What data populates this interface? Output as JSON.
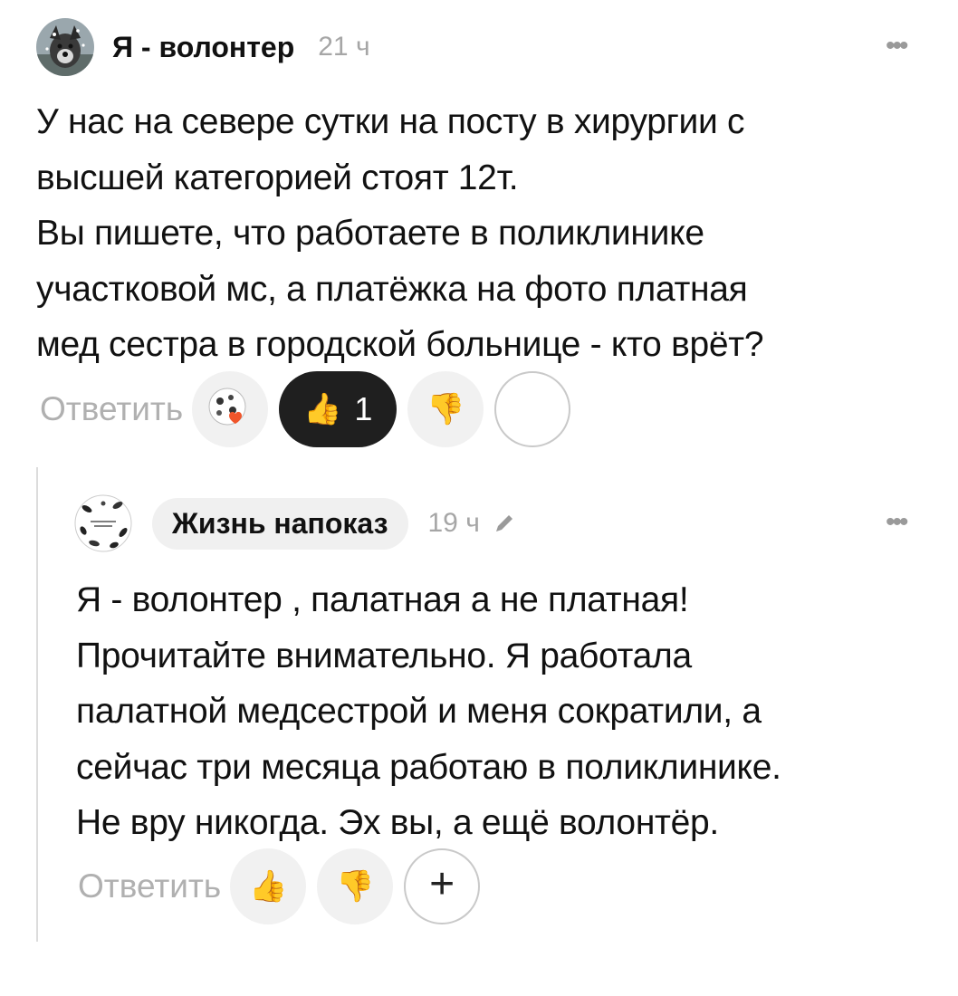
{
  "comment": {
    "author": "Я - волонтер",
    "time": "21 ч",
    "more": "•••",
    "text": "У нас на севере сутки на посту в хирургии с\nвысшей категорией стоят 12т.\nВы пишете, что работаете в поликлинике\nучастковой мс, а платёжка на фото платная\nмед сестра в городской больнице - кто врёт?",
    "reply_label": "Ответить",
    "like_count": "1"
  },
  "reply": {
    "author": "Жизнь напоказ",
    "time": "19 ч",
    "more": "•••",
    "text": "Я - волонтер , палатная а не платная!\nПрочитайте внимательно. Я работала\nпалатной медсестрой и меня сократили, а\nсейчас три месяца работаю в поликлинике.\nНе вру никогда. Эх вы, а ещё волонтёр.",
    "reply_label": "Ответить",
    "plus": "+"
  },
  "icons": {
    "like": "thumbs-up-icon",
    "dislike": "thumbs-down-icon",
    "edit": "pencil-icon",
    "more": "more-icon"
  },
  "colors": {
    "muted": "#a6a6a6",
    "chip_bg": "#f0f0f0",
    "dark_pill": "#1f1f1f",
    "heart": "#f0552a"
  }
}
